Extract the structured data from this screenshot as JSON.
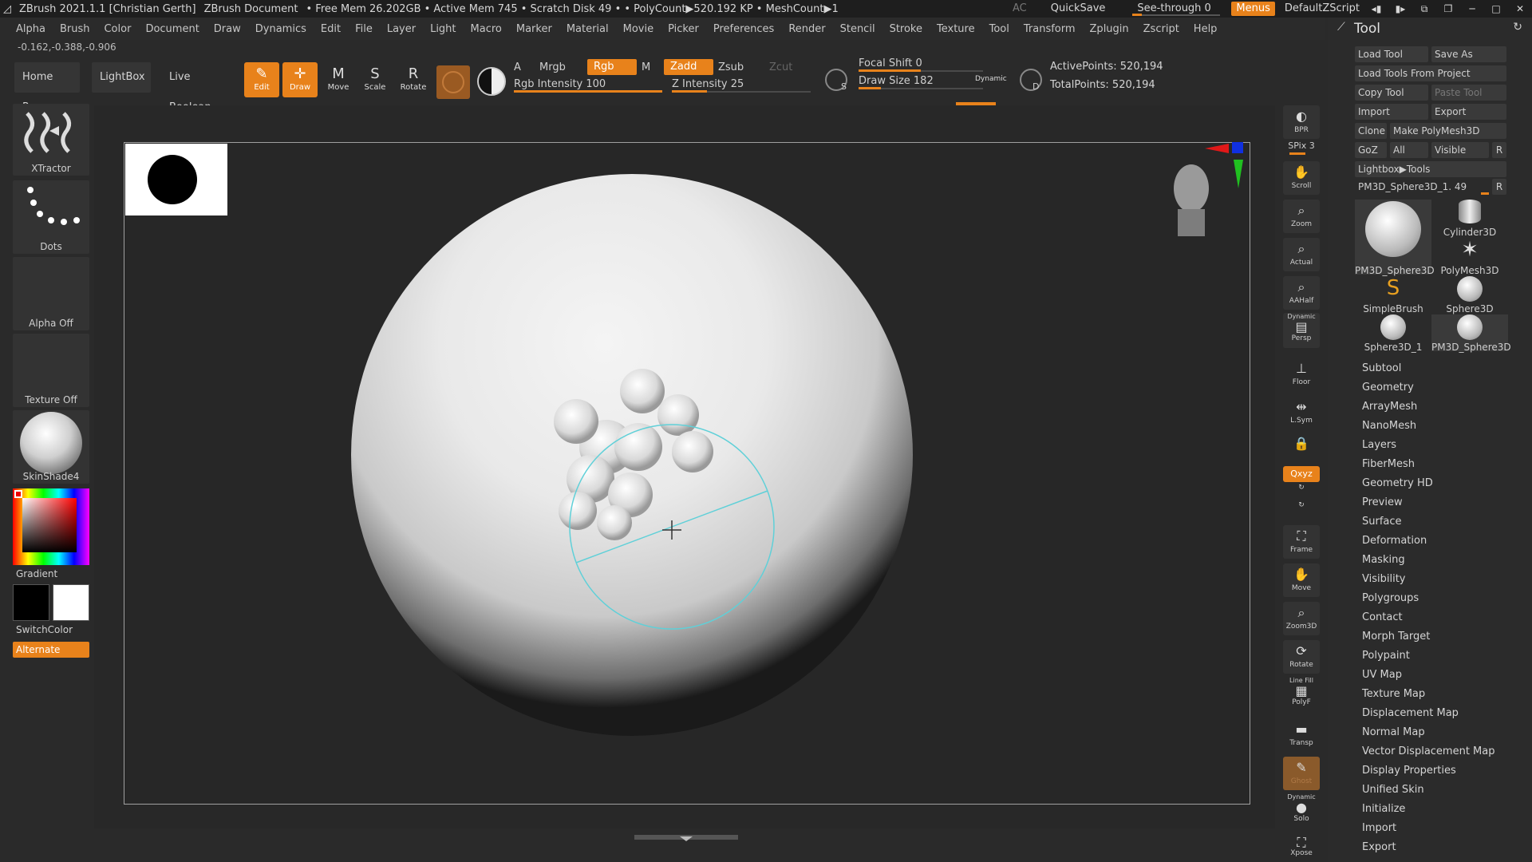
{
  "titlebar": {
    "app": "ZBrush 2021.1.1 [Christian Gerth]",
    "document": "ZBrush Document",
    "stats": "• Free Mem 26.202GB • Active Mem 745 • Scratch Disk 49 •  • PolyCount▶520.192 KP  • MeshCount▶1",
    "ac": "AC",
    "quicksave": "QuickSave",
    "see_through_label": "See-through  0",
    "menus": "Menus",
    "default_zscript": "DefaultZScript"
  },
  "menubar": [
    "Alpha",
    "Brush",
    "Color",
    "Document",
    "Draw",
    "Dynamics",
    "Edit",
    "File",
    "Layer",
    "Light",
    "Macro",
    "Marker",
    "Material",
    "Movie",
    "Picker",
    "Preferences",
    "Render",
    "Stencil",
    "Stroke",
    "Texture",
    "Tool",
    "Transform",
    "Zplugin",
    "Zscript",
    "Help"
  ],
  "coords": "-0.162,-0.388,-0.906",
  "toolbar": {
    "home_page": "Home Page",
    "lightbox": "LightBox",
    "live_boolean": "Live Boolean",
    "edit": "Edit",
    "draw": "Draw",
    "move": "Move",
    "scale": "Scale",
    "rotate": "Rotate",
    "a": "A",
    "mrgb": "Mrgb",
    "rgb": "Rgb",
    "m": "M",
    "zadd": "Zadd",
    "zsub": "Zsub",
    "zcut": "Zcut",
    "rgb_intensity_label": "Rgb Intensity 100",
    "rgb_intensity": 1.0,
    "z_intensity_label": "Z Intensity 25",
    "z_intensity": 0.25,
    "focal_shift_label": "Focal Shift 0",
    "focal_shift": 0.5,
    "draw_size_label": "Draw Size 182",
    "draw_size": 0.18,
    "dynamic": "Dynamic",
    "s": "S",
    "d": "D",
    "active_points": "ActivePoints: 520,194",
    "total_points": "TotalPoints: 520,194"
  },
  "leftshelf": {
    "brush": "XTractor",
    "stroke": "Dots",
    "alpha": "Alpha Off",
    "texture": "Texture Off",
    "material": "SkinShade4",
    "gradient": "Gradient",
    "switch_color": "SwitchColor",
    "alternate": "Alternate"
  },
  "rightshelf": {
    "bpr": "BPR",
    "spix": "SPix 3",
    "scroll": "Scroll",
    "zoom": "Zoom",
    "actual": "Actual",
    "aahalf": "AAHalf",
    "dynamic": "Dynamic",
    "persp": "Persp",
    "floor": "Floor",
    "lsym": "L.Sym",
    "xyz": "Qxyz",
    "frame": "Frame",
    "move": "Move",
    "zoom3d": "Zoom3D",
    "rotate": "Rotate",
    "line_fill": "Line Fill",
    "polyf": "PolyF",
    "transp": "Transp",
    "ghost": "Ghost",
    "solo_dynamic": "Dynamic",
    "solo": "Solo",
    "xpose": "Xpose"
  },
  "palette": {
    "title": "Tool",
    "load_tool": "Load Tool",
    "save_as": "Save As",
    "load_from_project": "Load Tools From Project",
    "copy_tool": "Copy Tool",
    "paste_tool": "Paste Tool",
    "import": "Import",
    "export": "Export",
    "clone": "Clone",
    "make_polymesh": "Make PolyMesh3D",
    "goz": "GoZ",
    "all": "All",
    "visible": "Visible",
    "r": "R",
    "lightbox_tools": "Lightbox▶Tools",
    "current_tool": "PM3D_Sphere3D_1. 49",
    "tools": [
      "PM3D_Sphere3D",
      "Cylinder3D",
      "PolyMesh3D",
      "SimpleBrush",
      "Sphere3D",
      "Sphere3D_1",
      "PM3D_Sphere3D"
    ],
    "sections": [
      "Subtool",
      "Geometry",
      "ArrayMesh",
      "NanoMesh",
      "Layers",
      "FiberMesh",
      "Geometry HD",
      "Preview",
      "Surface",
      "Deformation",
      "Masking",
      "Visibility",
      "Polygroups",
      "Contact",
      "Morph Target",
      "Polypaint",
      "UV Map",
      "Texture Map",
      "Displacement Map",
      "Normal Map",
      "Vector Displacement Map",
      "Display Properties",
      "Unified Skin",
      "Initialize",
      "Import",
      "Export"
    ]
  },
  "colors": {
    "accent": "#e8821b",
    "brush_circle": "#5fd0d8"
  }
}
